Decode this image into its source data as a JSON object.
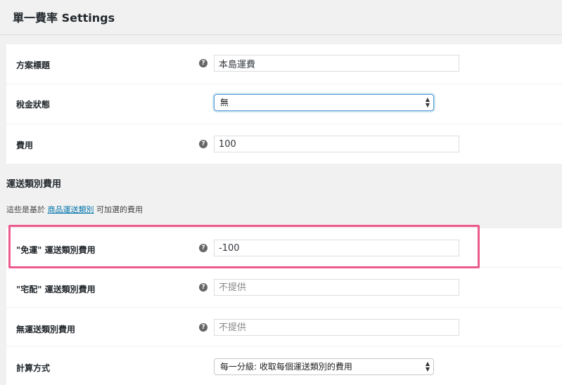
{
  "page": {
    "title": "單一費率 Settings"
  },
  "general": {
    "rows": [
      {
        "label": "方案標題",
        "value": "本島運費",
        "placeholder": ""
      },
      {
        "label": "稅金狀態",
        "selected": "無"
      },
      {
        "label": "費用",
        "value": "100",
        "placeholder": ""
      }
    ]
  },
  "classes": {
    "title": "運送類別費用",
    "desc_prefix": "這些是基於",
    "desc_link": "商品運送類別",
    "desc_suffix": "可加選的費用",
    "rows": [
      {
        "label": "\"免運\" 運送類別費用",
        "value": "-100",
        "placeholder": ""
      },
      {
        "label": "\"宅配\" 運送類別費用",
        "value": "",
        "placeholder": "不提供"
      },
      {
        "label": "無運送類別費用",
        "value": "",
        "placeholder": "不提供"
      },
      {
        "label": "計算方式",
        "selected": "每一分級: 收取每個運送類別的費用"
      }
    ]
  },
  "icons": {
    "help": "help-icon",
    "select_arrows": "select-arrows-icon"
  },
  "colors": {
    "highlight": "#ec5a8e",
    "link": "#0073aa",
    "focus": "#5b9dd9"
  }
}
